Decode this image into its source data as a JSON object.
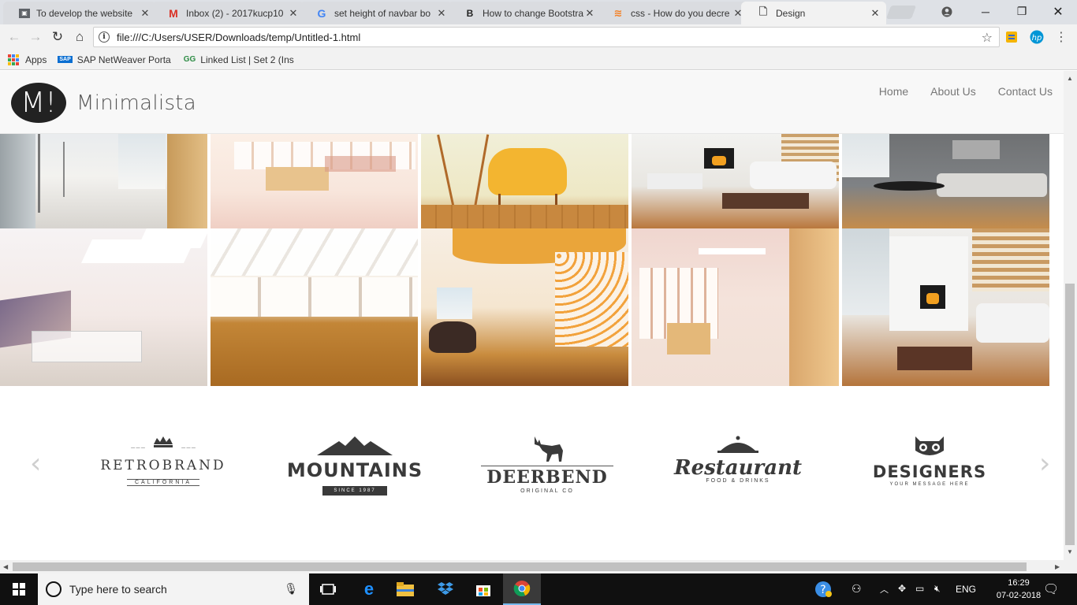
{
  "browser": {
    "tabs": [
      {
        "title": "To develop the website",
        "icon": "page-icon",
        "active": false
      },
      {
        "title": "Inbox (2) - 2017kucp10",
        "icon": "gmail-icon",
        "active": false
      },
      {
        "title": "set height of navbar bo",
        "icon": "google-icon",
        "active": false
      },
      {
        "title": "How to change Bootstra",
        "icon": "bootstrap-icon",
        "active": false
      },
      {
        "title": "css - How do you decre",
        "icon": "stackoverflow-icon",
        "active": false
      },
      {
        "title": "Design",
        "icon": "page-icon",
        "active": true
      }
    ],
    "address": "file:///C:/Users/USER/Downloads/temp/Untitled-1.html",
    "bookmarks": [
      {
        "label": "Apps",
        "icon": "apps-icon"
      },
      {
        "label": "SAP NetWeaver Porta",
        "icon": "sap-icon"
      },
      {
        "label": "Linked List | Set 2 (Ins",
        "icon": "gfg-icon"
      }
    ]
  },
  "site": {
    "logo_letter": "M!",
    "brand_name": "Minimalista",
    "nav_links": [
      "Home",
      "About Us",
      "Contact Us"
    ],
    "photos": [
      {
        "subject": "glass office corridor"
      },
      {
        "subject": "bright office with desks"
      },
      {
        "subject": "yellow armchair"
      },
      {
        "subject": "living room with fireplace"
      },
      {
        "subject": "grey sofa living room"
      },
      {
        "subject": "attic bedroom with skylights"
      },
      {
        "subject": "empty sunlit room"
      },
      {
        "subject": "orange modern interior"
      },
      {
        "subject": "long office hall"
      },
      {
        "subject": "fireplace lounge"
      }
    ],
    "brand_logos": [
      {
        "name": "RETROBRAND",
        "sub": "CALIFORNIA",
        "icon": "crown-icon"
      },
      {
        "name": "MOUNTAINS",
        "sub": "SINCE 1987",
        "icon": "mountain-icon"
      },
      {
        "name": "DEERBEND",
        "sub": "ORIGINAL CO",
        "icon": "deer-icon"
      },
      {
        "name": "Restaurant",
        "sub": "FOOD & DRINKS",
        "icon": "cloche-icon"
      },
      {
        "name": "DESIGNERS",
        "sub": "YOUR MESSAGE HERE",
        "icon": "owl-icon"
      }
    ]
  },
  "taskbar": {
    "search_placeholder": "Type here to search",
    "language": "ENG",
    "time": "16:29",
    "date": "07-02-2018"
  }
}
